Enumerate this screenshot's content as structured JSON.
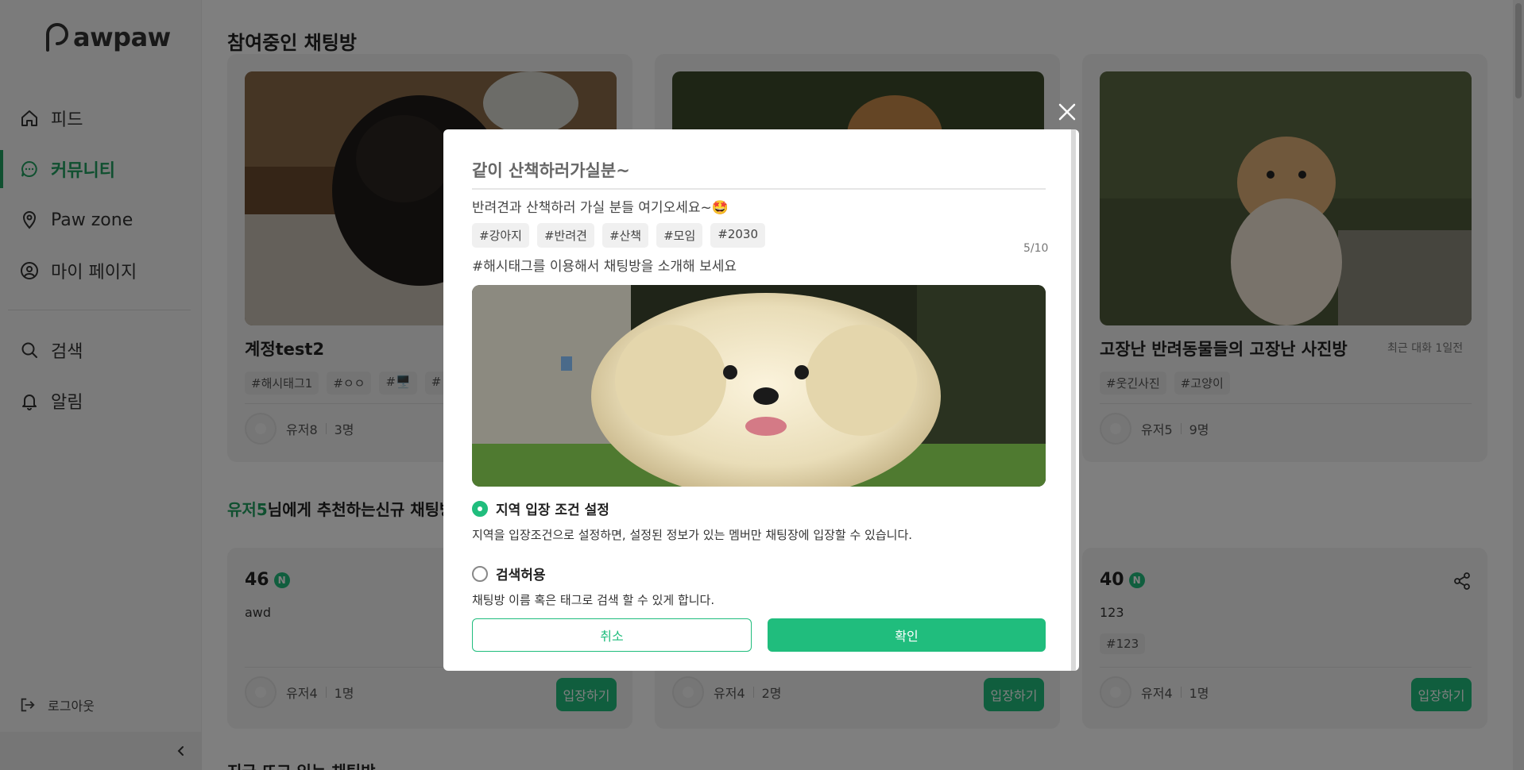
{
  "brand": {
    "logo_text": "awpaw"
  },
  "colors": {
    "accent": "#20bd7d",
    "accent_dark": "#20a060"
  },
  "sidebar": {
    "items": [
      {
        "label": "피드",
        "icon": "home-icon"
      },
      {
        "label": "커뮤니티",
        "icon": "chat-icon",
        "active": true
      },
      {
        "label": "Paw zone",
        "icon": "location-pin-icon"
      },
      {
        "label": "마이 페이지",
        "icon": "user-circle-icon"
      }
    ],
    "items2": [
      {
        "label": "검색",
        "icon": "search-icon"
      },
      {
        "label": "알림",
        "icon": "bell-icon"
      }
    ],
    "logout_label": "로그아웃"
  },
  "main": {
    "joined_title": "참여중인 채팅방",
    "joined_rooms": [
      {
        "title": "계정test2",
        "tags": [
          "#해시태그1",
          "#ㅇㅇ",
          "#🖥️",
          "#"
        ],
        "user": "유저8",
        "members": "3명"
      },
      {
        "title": "",
        "tags": [],
        "user": "",
        "members": ""
      },
      {
        "title": "고장난 반려동물들의 고장난 사진방",
        "last_chat": "최근 대화 1일전",
        "tags": [
          "#웃긴사진",
          "#고양이"
        ],
        "user": "유저5",
        "members": "9명"
      }
    ],
    "recommend_title_user": "유저5",
    "recommend_title_rest": "님에게 추천하는신규 채팅방",
    "recommend_rooms": [
      {
        "num": "46",
        "badge": "N",
        "desc": "awd",
        "tags": [],
        "user": "유저4",
        "members": "1명",
        "enter": "입장하기"
      },
      {
        "num": "",
        "badge": "",
        "desc": "",
        "tags": [],
        "user": "유저4",
        "members": "2명",
        "enter": "입장하기"
      },
      {
        "num": "40",
        "badge": "N",
        "desc": "123",
        "tags": [
          "#123"
        ],
        "user": "유저4",
        "members": "1명",
        "enter": "입장하기"
      }
    ],
    "bottom_title": "지금 뜨고 있는 채팅방"
  },
  "modal": {
    "title": "같이 산책하러가실분~",
    "desc": "반려견과 산책하러 가실 분들 여기오세요~🤩",
    "tags": [
      "#강아지",
      "#반려견",
      "#산책",
      "#모임",
      "#2030"
    ],
    "tag_count": "5/10",
    "hint": "#해시태그를 이용해서 채팅방을 소개해 보세요",
    "option1_label": "지역 입장 조건 설정",
    "option1_desc": "지역을 입장조건으로 설정하면, 설정된 정보가 있는 멤버만 채팅장에 입장할 수 있습니다.",
    "option2_label": "검색허용",
    "option2_desc": "채팅방 이름 혹은 태그로 검색 할 수 있게 합니다.",
    "cancel": "취소",
    "confirm": "확인"
  }
}
